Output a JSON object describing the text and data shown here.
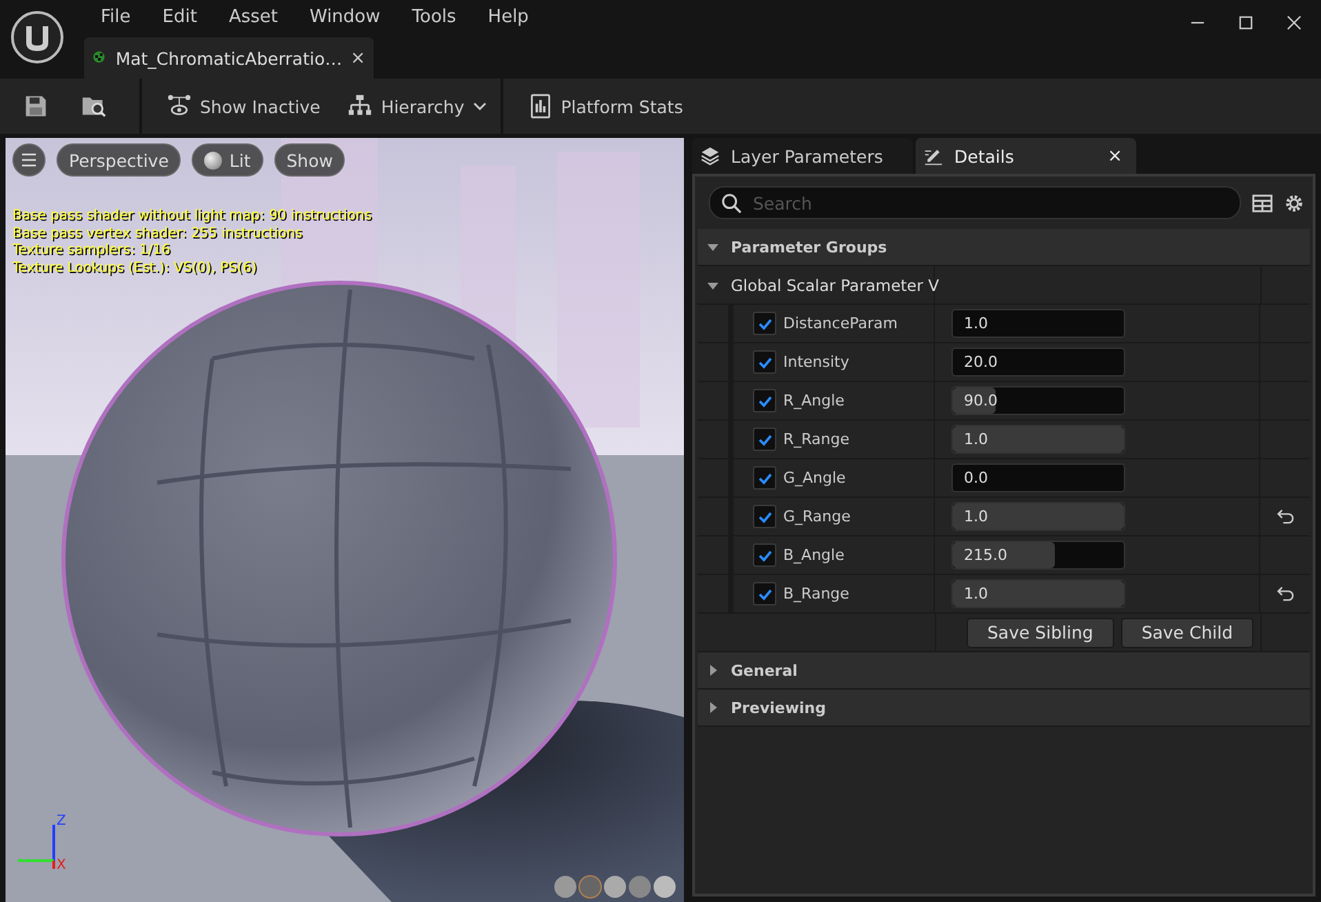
{
  "menu": [
    "File",
    "Edit",
    "Asset",
    "Window",
    "Tools",
    "Help"
  ],
  "document_tab": {
    "label": "Mat_ChromaticAberratio…",
    "close": "×"
  },
  "toolbar": [
    {
      "kind": "save"
    },
    {
      "kind": "browse"
    },
    {
      "kind": "toggle",
      "label": "Show Inactive"
    },
    {
      "kind": "dropdown",
      "label": "Hierarchy"
    },
    {
      "kind": "stats",
      "label": "Platform Stats"
    }
  ],
  "viewport": {
    "buttons": [
      {
        "kind": "menu"
      },
      {
        "kind": "text",
        "label": "Perspective"
      },
      {
        "kind": "lit",
        "label": "Lit"
      },
      {
        "kind": "text",
        "label": "Show"
      }
    ],
    "stats": [
      "Base pass shader without light map: 90 instructions",
      "Base pass vertex shader: 255 instructions",
      "Texture samplers: 1/16",
      "Texture Lookups (Est.): VS(0), PS(6)"
    ],
    "axes": {
      "z": "Z",
      "x": "X"
    }
  },
  "panel_tabs": [
    {
      "label": "Layer Parameters",
      "selected": false
    },
    {
      "label": "Details",
      "selected": true,
      "close": "×"
    }
  ],
  "search": {
    "placeholder": "Search"
  },
  "sections": [
    {
      "title": "Parameter Groups",
      "expanded": true
    },
    {
      "title": "General",
      "expanded": false
    },
    {
      "title": "Previewing",
      "expanded": false
    }
  ],
  "group": {
    "title": "Global Scalar Parameter V",
    "expanded": true
  },
  "parameters": [
    {
      "name": "DistanceParam",
      "checked": true,
      "value": "1.0",
      "level": 0,
      "reset": false
    },
    {
      "name": "Intensity",
      "checked": true,
      "value": "20.0",
      "level": 0,
      "reset": false
    },
    {
      "name": "R_Angle",
      "checked": true,
      "value": "90.0",
      "level": 0.25,
      "reset": false
    },
    {
      "name": "R_Range",
      "checked": true,
      "value": "1.0",
      "level": 1,
      "reset": false
    },
    {
      "name": "G_Angle",
      "checked": true,
      "value": "0.0",
      "level": 0,
      "reset": false
    },
    {
      "name": "G_Range",
      "checked": true,
      "value": "1.0",
      "level": 1,
      "reset": true
    },
    {
      "name": "B_Angle",
      "checked": true,
      "value": "215.0",
      "level": 0.6,
      "reset": false
    },
    {
      "name": "B_Range",
      "checked": true,
      "value": "1.0",
      "level": 1,
      "reset": true
    }
  ],
  "buttons": [
    "Save Sibling",
    "Save Child"
  ]
}
